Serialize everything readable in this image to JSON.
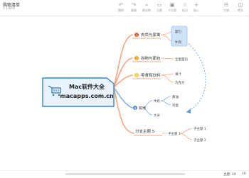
{
  "window": {
    "title": "购物清单",
    "subtitle": "1 100%"
  },
  "toolbar": {
    "items": [
      {
        "icon": "undo-icon",
        "glyph": "↶",
        "label": "撤销"
      },
      {
        "icon": "redo-icon",
        "glyph": "↷",
        "label": "重做"
      },
      {
        "icon": "format-painter-icon",
        "glyph": "⌁",
        "label": "格式刷"
      },
      {
        "icon": "topic-icon",
        "glyph": "▭",
        "label": "主题"
      },
      {
        "icon": "subtopic-icon",
        "glyph": "▣",
        "label": "子主题"
      },
      {
        "icon": "marker-icon",
        "glyph": "☆",
        "label": "标记"
      },
      {
        "icon": "insert-icon",
        "glyph": "+",
        "label": "插入"
      }
    ],
    "right_items": [
      {
        "icon": "outline-icon",
        "glyph": "☷",
        "label": "大纲"
      },
      {
        "icon": "format-panel-icon",
        "glyph": "◫",
        "label": "格式"
      }
    ]
  },
  "central": {
    "line1": "Mac软件大全",
    "line2": "macapps.com.cn"
  },
  "branches": [
    {
      "label": "肉类与家禽",
      "marker": "1",
      "marker_color": "#e4572e",
      "color": "#f4a582",
      "children": [
        "面包",
        "牛肉"
      ]
    },
    {
      "label": "谷物与面包",
      "marker": "2",
      "marker_color": "#f0a202",
      "color": "#f4a582",
      "children": [
        "全麦面包"
      ]
    },
    {
      "label": "零食和饮料",
      "marker": "3",
      "marker_color": "#f6c945",
      "color": "#f4a582",
      "children": [
        "果汁",
        "饼干",
        "巧克力"
      ]
    },
    {
      "label": "其他",
      "marker": "4",
      "marker_color": "#4a90d9",
      "color": "#7fb3e6",
      "children": [
        "牛奶",
        "黄油",
        "鸡蛋",
        "大米"
      ]
    },
    {
      "label": "分支主题 5",
      "marker": "",
      "marker_color": "",
      "color": "#f4a582",
      "children": [
        "子主题 1",
        "子主题 2"
      ]
    }
  ],
  "subtopics": {
    "parent": "子主题 1"
  },
  "status": {
    "topic_count": "主题: 19",
    "zoom": "10"
  },
  "colors": {
    "branch_orange": "#f4a582",
    "branch_blue": "#7fb3e6",
    "central_border": "#3a86d6",
    "selection": "#cfe2f7"
  }
}
